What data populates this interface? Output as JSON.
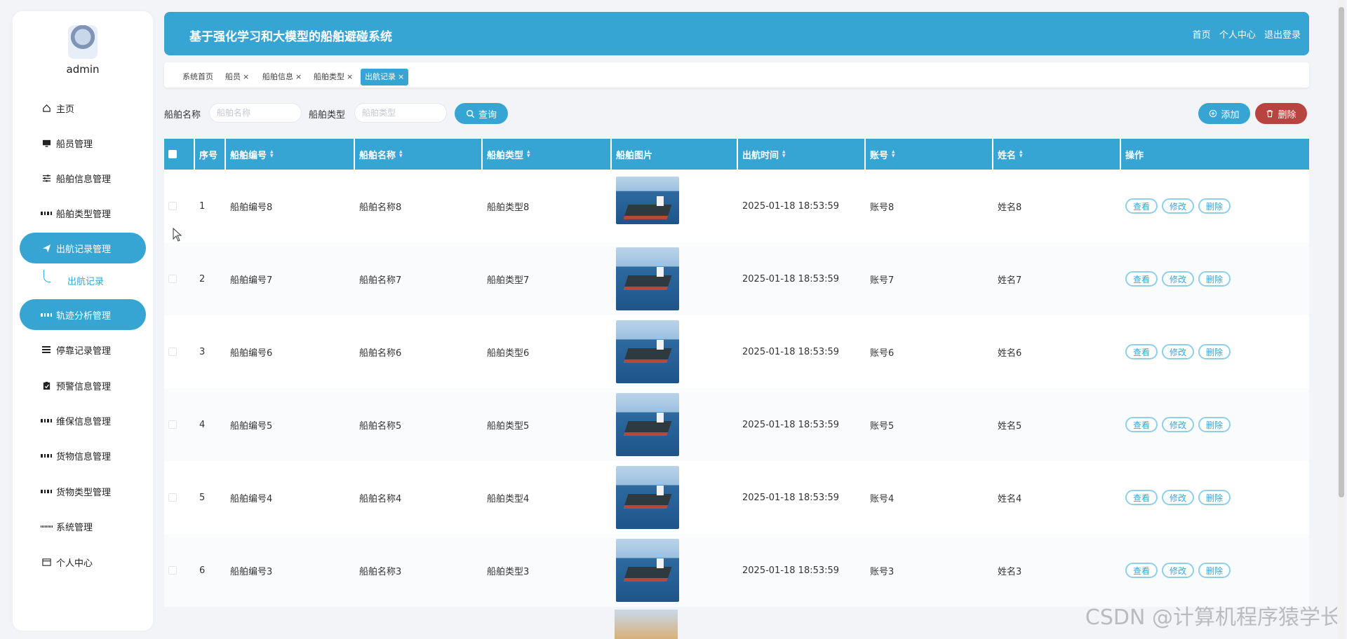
{
  "sidebar": {
    "username": "admin",
    "items": [
      {
        "label": "主页",
        "icon": "home-icon"
      },
      {
        "label": "船员管理",
        "icon": "monitor-icon"
      },
      {
        "label": "船舶信息管理",
        "icon": "sliders-icon"
      },
      {
        "label": "船舶类型管理",
        "icon": "grid-icon"
      },
      {
        "label": "出航记录管理",
        "icon": "send-icon"
      },
      {
        "label": "轨迹分析管理",
        "icon": "grid-icon"
      },
      {
        "label": "停靠记录管理",
        "icon": "list-icon"
      },
      {
        "label": "预警信息管理",
        "icon": "clipboard-icon"
      },
      {
        "label": "维保信息管理",
        "icon": "grid-icon"
      },
      {
        "label": "货物信息管理",
        "icon": "grid-icon"
      },
      {
        "label": "货物类型管理",
        "icon": "grid-icon"
      },
      {
        "label": "系统管理",
        "icon": "grid9-icon"
      },
      {
        "label": "个人中心",
        "icon": "card-icon"
      }
    ],
    "sub_item": "出航记录"
  },
  "header": {
    "title": "基于强化学习和大模型的船舶避碰系统",
    "links": [
      "首页",
      "个人中心",
      "退出登录"
    ]
  },
  "tabs": [
    {
      "label": "系统首页"
    },
    {
      "label": "船员"
    },
    {
      "label": "船舶信息"
    },
    {
      "label": "船舶类型"
    },
    {
      "label": "出航记录"
    }
  ],
  "tab_close": "×",
  "search": {
    "ship_name_label": "船舶名称",
    "ship_name_placeholder": "船舶名称",
    "ship_type_label": "船舶类型",
    "ship_type_placeholder": "船舶类型",
    "query_label": "查询",
    "add_label": "添加",
    "delete_label": "删除"
  },
  "table": {
    "columns": [
      "序号",
      "船舶编号",
      "船舶名称",
      "船舶类型",
      "船舶图片",
      "出航时间",
      "账号",
      "姓名",
      "操作"
    ],
    "actions": [
      "查看",
      "修改",
      "删除"
    ],
    "rows": [
      {
        "no": "1",
        "code": "船舶编号8",
        "name": "船舶名称8",
        "type": "船舶类型8",
        "time": "2025-01-18 18:53:59",
        "account": "账号8",
        "person": "姓名8"
      },
      {
        "no": "2",
        "code": "船舶编号7",
        "name": "船舶名称7",
        "type": "船舶类型7",
        "time": "2025-01-18 18:53:59",
        "account": "账号7",
        "person": "姓名7"
      },
      {
        "no": "3",
        "code": "船舶编号6",
        "name": "船舶名称6",
        "type": "船舶类型6",
        "time": "2025-01-18 18:53:59",
        "account": "账号6",
        "person": "姓名6"
      },
      {
        "no": "4",
        "code": "船舶编号5",
        "name": "船舶名称5",
        "type": "船舶类型5",
        "time": "2025-01-18 18:53:59",
        "account": "账号5",
        "person": "姓名5"
      },
      {
        "no": "5",
        "code": "船舶编号4",
        "name": "船舶名称4",
        "type": "船舶类型4",
        "time": "2025-01-18 18:53:59",
        "account": "账号4",
        "person": "姓名4"
      },
      {
        "no": "6",
        "code": "船舶编号3",
        "name": "船舶名称3",
        "type": "船舶类型3",
        "time": "2025-01-18 18:53:59",
        "account": "账号3",
        "person": "姓名3"
      }
    ]
  },
  "watermark": "CSDN @计算机程序猿学长",
  "colors": {
    "accent": "#37a5d3",
    "danger": "#b8443f"
  }
}
